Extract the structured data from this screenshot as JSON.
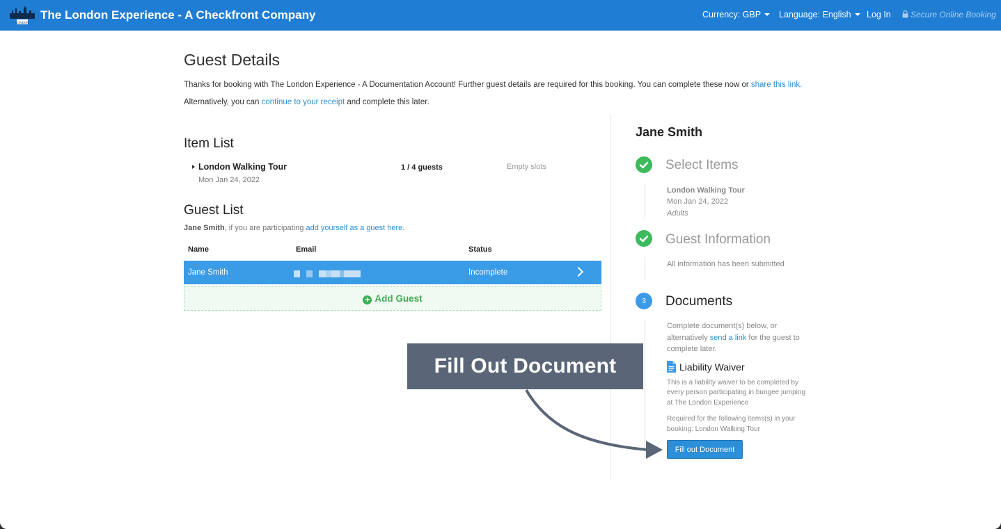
{
  "header": {
    "brand": "The London Experience - A Checkfront Company",
    "logo_text": "LONDON",
    "currency": "Currency: GBP",
    "language": "Language: English",
    "login": "Log In",
    "secure": "Secure Online Booking"
  },
  "main": {
    "title": "Guest Details",
    "intro1_text": "Thanks for booking with The London Experience - A Documentation Account! Further guest details are required for this booking. You can complete these now or ",
    "intro1_link": "share this link.",
    "intro2_pre": "Alternatively, you can ",
    "intro2_link": "continue to your receipt",
    "intro2_post": " and complete this later.",
    "item_list": {
      "heading": "Item List",
      "items": [
        {
          "name": "London Walking Tour",
          "date": "Mon Jan 24, 2022",
          "guests_count": "1",
          "guests_total": " / 4 guests",
          "slots": "Empty slots"
        }
      ]
    },
    "guest_list": {
      "heading": "Guest List",
      "note_name": "Jane Smith",
      "note_text": ", if you are participating ",
      "note_link": "add yourself as a guest here.",
      "columns": [
        "Name",
        "Email",
        "Status"
      ],
      "rows": [
        {
          "name": "Jane Smith",
          "status": "Incomplete"
        }
      ],
      "add_label": "Add Guest"
    }
  },
  "sidebar": {
    "guest_name": "Jane Smith",
    "steps": [
      {
        "label": "Select Items",
        "item": "London Walking Tour",
        "date": "Mon Jan 24, 2022",
        "type": "Adults"
      },
      {
        "label": "Guest Information",
        "note": "All information has been submitted"
      },
      {
        "number": "3",
        "label": "Documents",
        "desc1": "Complete document(s) below, or",
        "desc2_pre": "alternatively ",
        "desc2_link": "send a link",
        "desc2_post": " for the guest to",
        "desc3": "complete later.",
        "doc_title": "Liability Waiver",
        "doc_desc1": "This is a liability waiver to be completed by",
        "doc_desc2": "every person participating in bungee jumping",
        "doc_desc3": "at The London Experience",
        "req1": "Required for the following items(s) in your",
        "req2": "booking: London Walking Tour",
        "button": "Fill out Document"
      }
    ]
  },
  "callout": {
    "text": "Fill Out Document"
  },
  "colors": {
    "nav": "#1f7dd4",
    "accent": "#2b8ed6",
    "success": "#3dba5c",
    "row_highlight": "#3a9be6",
    "callout": "#5a6677"
  }
}
